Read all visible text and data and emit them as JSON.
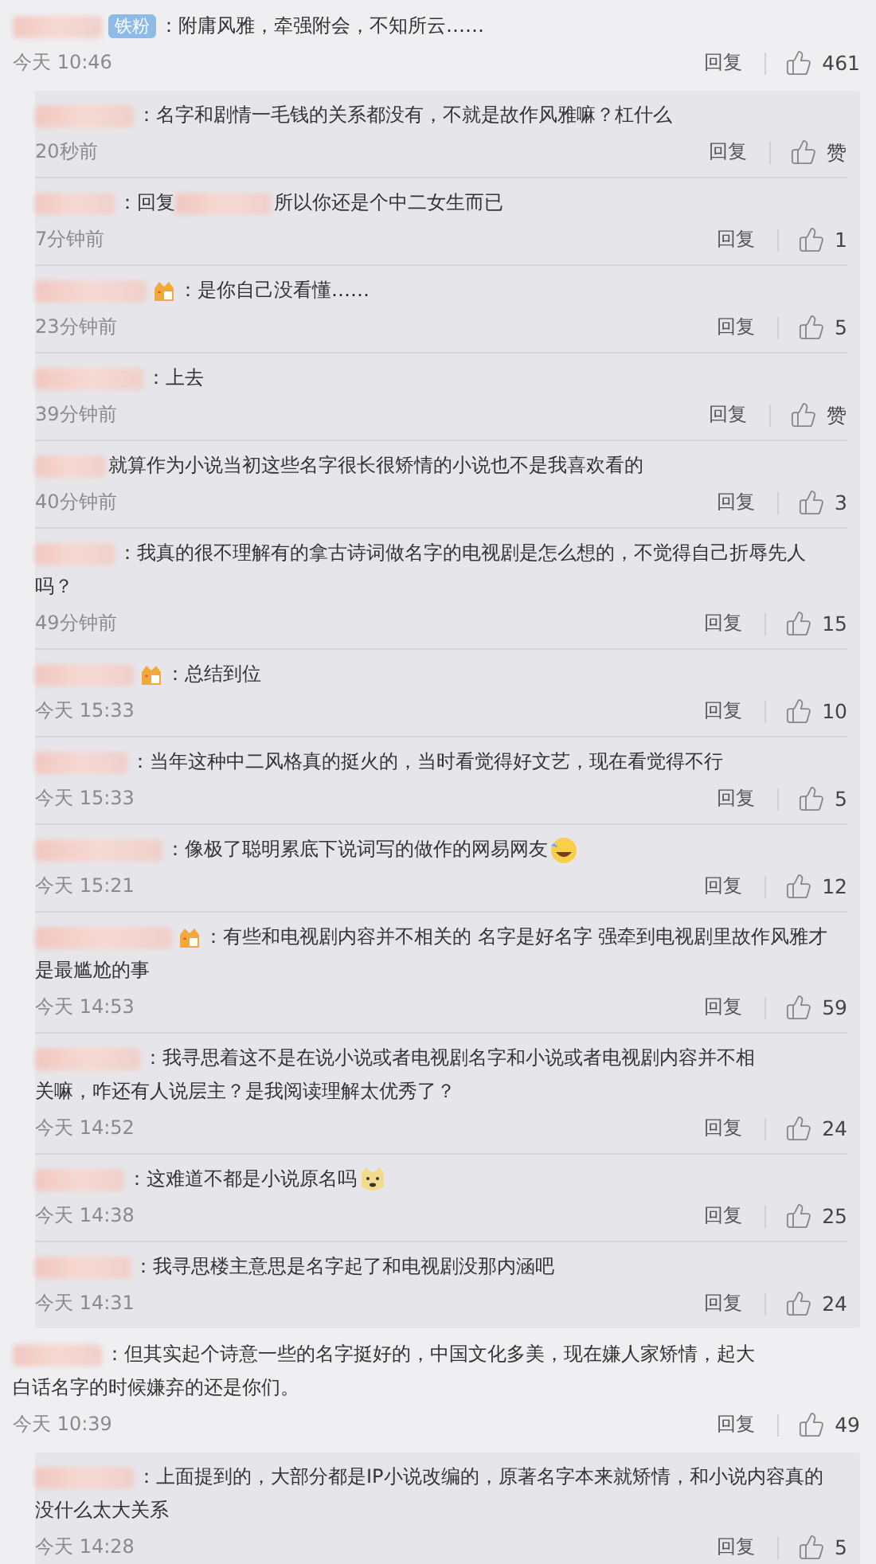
{
  "threads": [
    {
      "comment": {
        "badge": "铁粉",
        "lines": [
          "：附庸风雅，牵强附会，不知所云……"
        ],
        "time": "今天 10:46",
        "reply_label": "回复",
        "likes": "461"
      },
      "replies": [
        {
          "lines": [
            "：名字和剧情一毛钱的关系都没有，不就是故作风雅嘛？杠什么"
          ],
          "time": "20秒前",
          "reply_label": "回复",
          "likes": "赞"
        },
        {
          "lead": "：回复",
          "lines": [
            "所以你还是个中二女生而已"
          ],
          "time": "7分钟前",
          "reply_label": "回复",
          "likes": "1"
        },
        {
          "medal": true,
          "lines": [
            "：是你自己没看懂……"
          ],
          "time": "23分钟前",
          "reply_label": "回复",
          "likes": "5"
        },
        {
          "lines": [
            "：上去"
          ],
          "time": "39分钟前",
          "reply_label": "回复",
          "likes": "赞"
        },
        {
          "lines": [
            "就算作为小说当初这些名字很长很矫情的小说也不是我喜欢看的"
          ],
          "time": "40分钟前",
          "reply_label": "回复",
          "likes": "3"
        },
        {
          "lines": [
            "：我真的很不理解有的拿古诗词做名字的电视剧是怎么想的，不觉得自己折辱先人",
            "吗？"
          ],
          "time": "49分钟前",
          "reply_label": "回复",
          "likes": "15"
        },
        {
          "medal": true,
          "lines": [
            "：总结到位"
          ],
          "time": "今天 15:33",
          "reply_label": "回复",
          "likes": "10"
        },
        {
          "lines": [
            "：当年这种中二风格真的挺火的，当时看觉得好文艺，现在看觉得不行"
          ],
          "time": "今天 15:33",
          "reply_label": "回复",
          "likes": "5"
        },
        {
          "lines": [
            "：像极了聪明累底下说词写的做作的网易网友"
          ],
          "emoji": {
            "kind": "tears"
          },
          "time": "今天 15:21",
          "reply_label": "回复",
          "likes": "12"
        },
        {
          "medal": true,
          "lines": [
            "：有些和电视剧内容并不相关的 名字是好名字 强牵到电视剧里故作风雅才",
            "是最尴尬的事"
          ],
          "time": "今天 14:53",
          "reply_label": "回复",
          "likes": "59"
        },
        {
          "lines": [
            "：我寻思着这不是在说小说或者电视剧名字和小说或者电视剧内容并不相",
            "关嘛，咋还有人说层主？是我阅读理解太优秀了？"
          ],
          "time": "今天 14:52",
          "reply_label": "回复",
          "likes": "24"
        },
        {
          "lines": [
            "：这难道不都是小说原名吗"
          ],
          "emoji": {
            "kind": "doge"
          },
          "time": "今天 14:38",
          "reply_label": "回复",
          "likes": "25"
        },
        {
          "lines": [
            "：我寻思楼主意思是名字起了和电视剧没那内涵吧"
          ],
          "time": "今天 14:31",
          "reply_label": "回复",
          "likes": "24"
        }
      ]
    },
    {
      "comment": {
        "lines": [
          "：但其实起个诗意一些的名字挺好的，中国文化多美，现在嫌人家矫情，起大",
          "白话名字的时候嫌弃的还是你们。"
        ],
        "time": "今天 10:39",
        "reply_label": "回复",
        "likes": "49"
      },
      "replies": [
        {
          "lines": [
            "：上面提到的，大部分都是IP小说改编的，原著名字本来就矫情，和小说内容真的",
            "没什么太大关系"
          ],
          "time": "今天 14:28",
          "reply_label": "回复",
          "likes": "5"
        }
      ]
    }
  ]
}
